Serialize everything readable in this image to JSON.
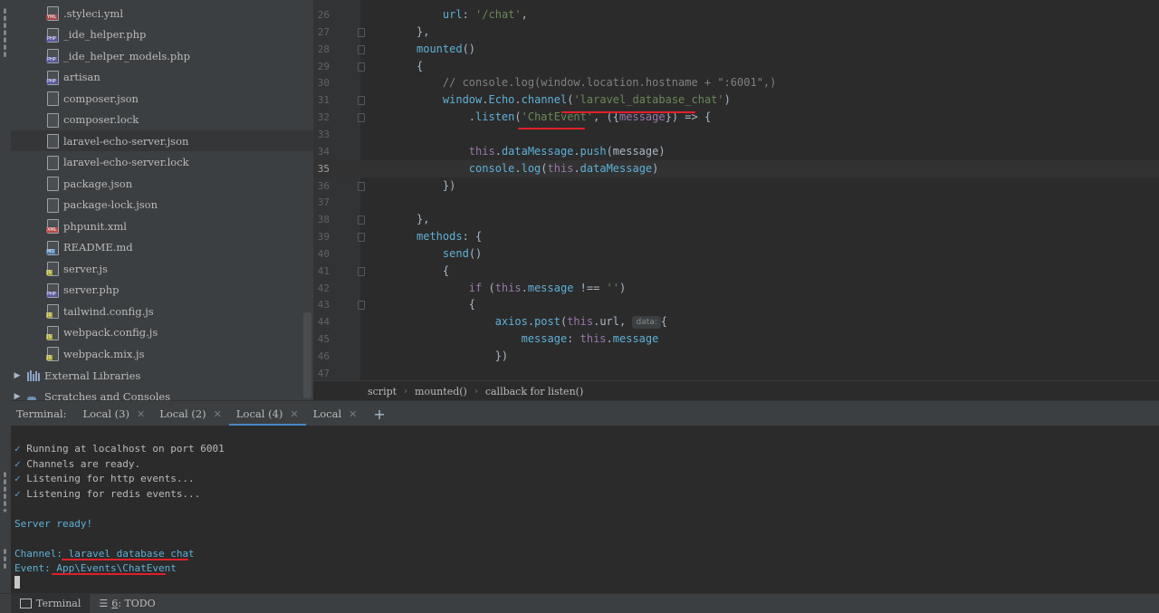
{
  "project_tree": {
    "files": [
      {
        "name": ".styleci.yml",
        "tag": "YML",
        "tag_color": "#a54a4a"
      },
      {
        "name": "_ide_helper.php",
        "tag": "PHP",
        "tag_color": "#5a5aa0"
      },
      {
        "name": "_ide_helper_models.php",
        "tag": "PHP",
        "tag_color": "#5a5aa0"
      },
      {
        "name": "artisan",
        "tag": "PHP",
        "tag_color": "#5a5aa0"
      },
      {
        "name": "composer.json",
        "tag": "",
        "tag_color": ""
      },
      {
        "name": "composer.lock",
        "tag": "",
        "tag_color": ""
      },
      {
        "name": "laravel-echo-server.json",
        "tag": "",
        "tag_color": ""
      },
      {
        "name": "laravel-echo-server.lock",
        "tag": "",
        "tag_color": ""
      },
      {
        "name": "package.json",
        "tag": "",
        "tag_color": ""
      },
      {
        "name": "package-lock.json",
        "tag": "",
        "tag_color": ""
      },
      {
        "name": "phpunit.xml",
        "tag": "XML",
        "tag_color": "#b54a4a"
      },
      {
        "name": "README.md",
        "tag": "MD",
        "tag_color": "#4a7aa8"
      },
      {
        "name": "server.js",
        "tag": "JS",
        "tag_color": "#a8a33a"
      },
      {
        "name": "server.php",
        "tag": "PHP",
        "tag_color": "#5a5aa0"
      },
      {
        "name": "tailwind.config.js",
        "tag": "JS",
        "tag_color": "#a8a33a"
      },
      {
        "name": "webpack.config.js",
        "tag": "JS",
        "tag_color": "#a8a33a"
      },
      {
        "name": "webpack.mix.js",
        "tag": "JS",
        "tag_color": "#a8a33a"
      }
    ],
    "external_libraries": "External Libraries",
    "scratches": "Scratches and Consoles"
  },
  "editor": {
    "current_line": 35,
    "line_numbers": [
      "26",
      "27",
      "28",
      "29",
      "30",
      "31",
      "32",
      "33",
      "34",
      "35",
      "36",
      "37",
      "38",
      "39",
      "40",
      "41",
      "42",
      "43",
      "44",
      "45",
      "46",
      "47"
    ],
    "hint_label": "data:"
  },
  "breadcrumb": {
    "items": [
      "script",
      "mounted()",
      "callback for listen()"
    ]
  },
  "terminal": {
    "title": "Terminal:",
    "tabs": [
      "Local (3)",
      "Local (2)",
      "Local (4)",
      "Local"
    ],
    "active_tab": "Local (4)",
    "check_mark": "✓",
    "lines": [
      "Running at localhost on port 6001",
      "Channels are ready.",
      "Listening for http events...",
      "Listening for redis events..."
    ],
    "server_ready": "Server ready!",
    "channel_label": "Channel:",
    "channel_value": "laravel_database_chat",
    "event_label": "Event:",
    "event_value": "App\\Events\\ChatEvent"
  },
  "bottom_bar": {
    "terminal_label": "Terminal",
    "todo_number": "6",
    "todo_label": ": TODO"
  },
  "colors": {
    "annotation_red": "#e0202a",
    "active_tab_underline": "#4a88c7"
  }
}
